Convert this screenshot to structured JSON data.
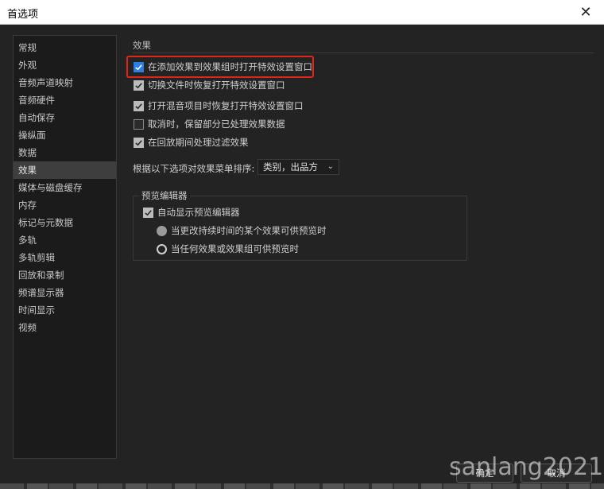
{
  "window": {
    "title": "首选项",
    "close_glyph": "✕"
  },
  "sidebar": {
    "items": [
      {
        "label": "常规"
      },
      {
        "label": "外观"
      },
      {
        "label": "音频声道映射"
      },
      {
        "label": "音频硬件"
      },
      {
        "label": "自动保存"
      },
      {
        "label": "操纵面"
      },
      {
        "label": "数据"
      },
      {
        "label": "效果",
        "selected": true
      },
      {
        "label": "媒体与磁盘缓存"
      },
      {
        "label": "内存"
      },
      {
        "label": "标记与元数据"
      },
      {
        "label": "多轨"
      },
      {
        "label": "多轨剪辑"
      },
      {
        "label": "回放和录制"
      },
      {
        "label": "频谱显示器"
      },
      {
        "label": "时间显示"
      },
      {
        "label": "视频"
      }
    ]
  },
  "effects": {
    "section_title": "效果",
    "options": [
      {
        "label": "在添加效果到效果组时打开特效设置窗口",
        "checked": true,
        "highlighted": true
      },
      {
        "label": "切换文件时恢复打开特效设置窗口",
        "checked": true
      },
      {
        "label": "打开混音项目时恢复打开特效设置窗口",
        "checked": true
      },
      {
        "label": "取消时，保留部分已处理效果数据",
        "checked": false
      },
      {
        "label": "在回放期间处理过滤效果",
        "checked": true
      }
    ],
    "sort_label": "根据以下选项对效果菜单排序:",
    "sort_value": "类别，出品方",
    "preview_group": {
      "title": "预览编辑器",
      "auto_show_label": "自动显示预览编辑器",
      "auto_show_checked": true,
      "radios": [
        {
          "label": "当更改持续时间的某个效果可供预览时",
          "selected": true
        },
        {
          "label": "当任何效果或效果组可供预览时",
          "selected": false
        }
      ]
    }
  },
  "footer": {
    "ok_label": "确定",
    "cancel_label": "取消"
  },
  "watermark": "sanlang2021",
  "colors": {
    "background": "#232323",
    "accent_blue": "#2d7ee0",
    "highlight_red": "#e0251b"
  }
}
